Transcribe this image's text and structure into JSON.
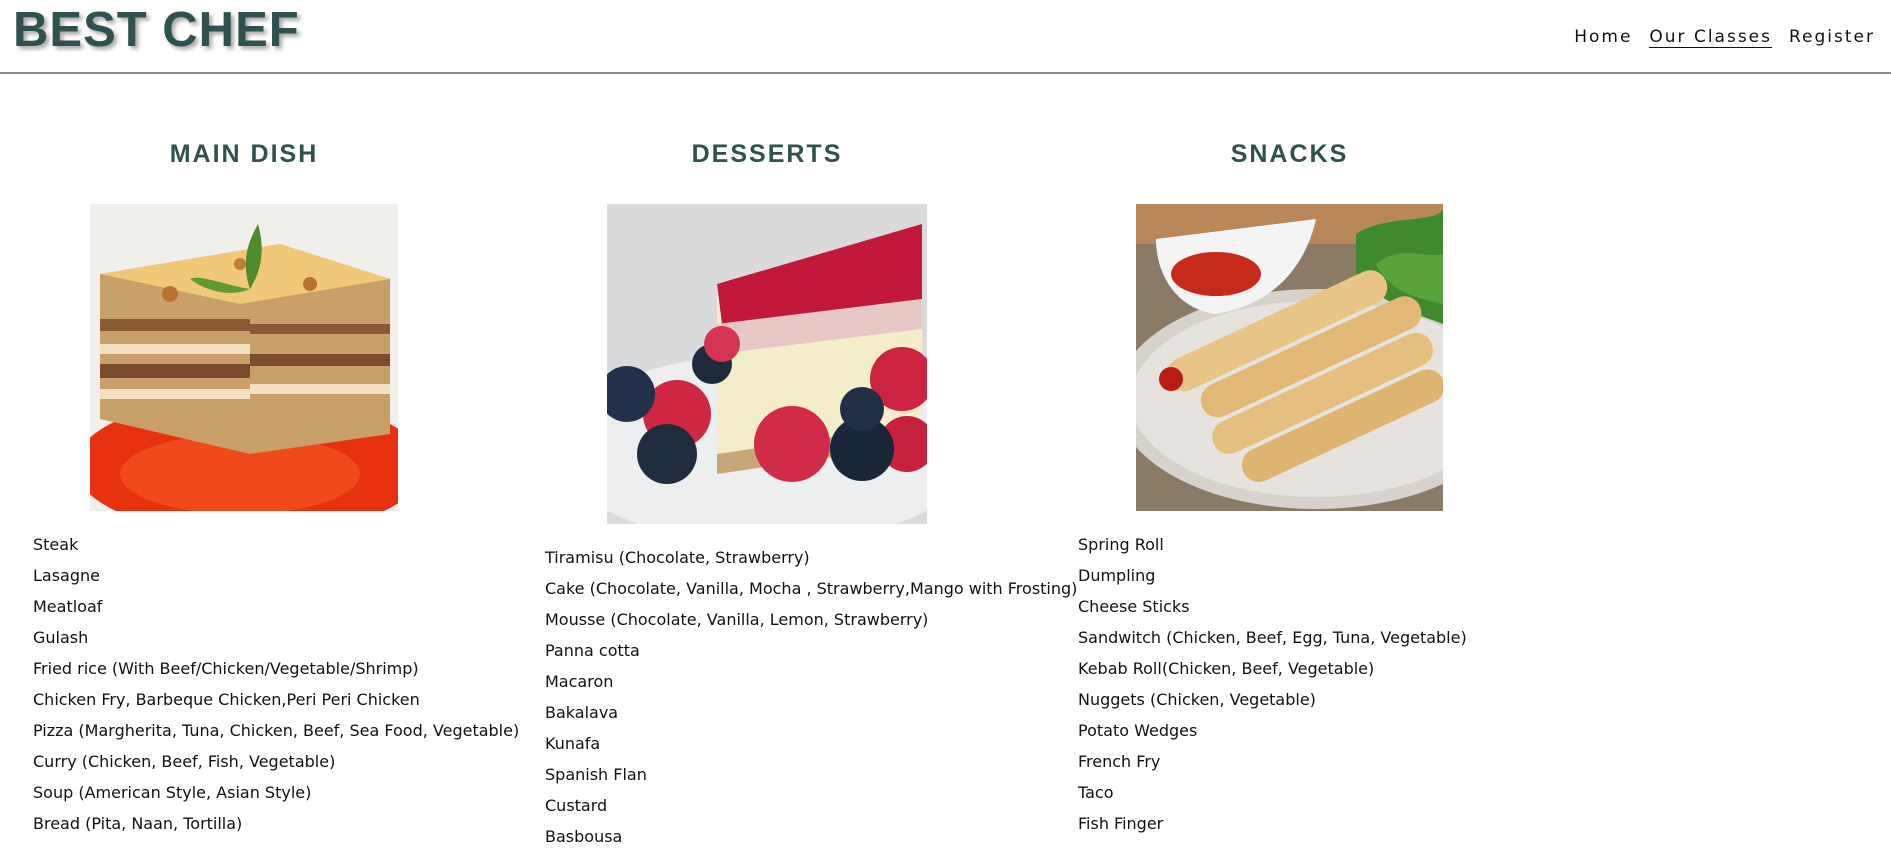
{
  "site": {
    "logo": "BEST CHEF"
  },
  "nav": [
    {
      "label": "Home",
      "active": false
    },
    {
      "label": "Our Classes",
      "active": true
    },
    {
      "label": "Register",
      "active": false
    }
  ],
  "categories": [
    {
      "title": "MAIN DISH",
      "image": "lasagne-icon",
      "items": [
        "Steak",
        "Lasagne",
        "Meatloaf",
        "Gulash",
        "Fried rice (With Beef/Chicken/Vegetable/Shrimp)",
        "Chicken Fry, Barbeque Chicken,Peri Peri Chicken",
        "Pizza (Margherita, Tuna, Chicken, Beef, Sea Food, Vegetable)",
        "Curry (Chicken, Beef, Fish, Vegetable)",
        "Soup (American Style, Asian Style)",
        "Bread (Pita, Naan, Tortilla)"
      ]
    },
    {
      "title": "DESSERTS",
      "image": "cheesecake-icon",
      "items": [
        "Tiramisu (Chocolate, Strawberry)",
        "Cake (Chocolate, Vanilla, Mocha , Strawberry,Mango with Frosting)",
        "Mousse (Chocolate, Vanilla, Lemon, Strawberry)",
        "Panna cotta",
        "Macaron",
        "Bakalava",
        "Kunafa",
        "Spanish Flan",
        "Custard",
        "Basbousa"
      ]
    },
    {
      "title": "SNACKS",
      "image": "spring-roll-icon",
      "items": [
        "Spring Roll",
        "Dumpling",
        "Cheese Sticks",
        "Sandwitch (Chicken, Beef, Egg, Tuna, Vegetable)",
        "Kebab Roll(Chicken, Beef, Vegetable)",
        "Nuggets (Chicken, Vegetable)",
        "Potato Wedges",
        "French Fry",
        "Taco",
        "Fish Finger"
      ]
    }
  ]
}
